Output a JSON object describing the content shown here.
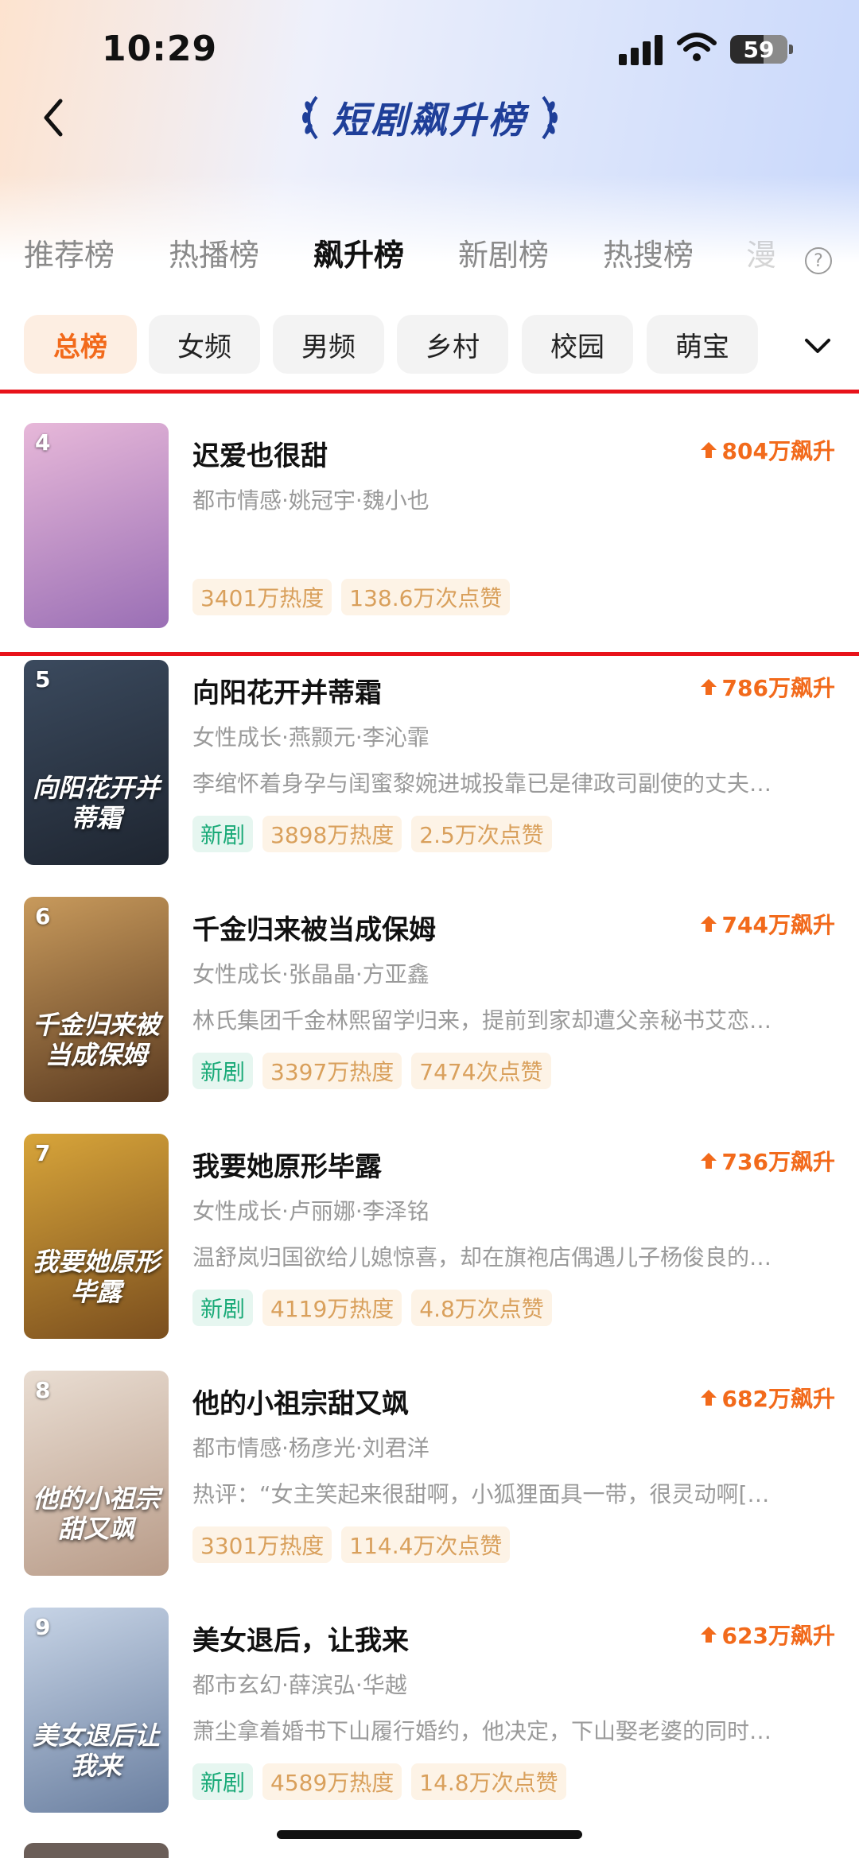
{
  "status_bar": {
    "time": "10:29",
    "battery": "59"
  },
  "header": {
    "title": "短剧飙升榜"
  },
  "main_tabs": [
    {
      "label": "推荐榜"
    },
    {
      "label": "热播榜"
    },
    {
      "label": "飙升榜"
    },
    {
      "label": "新剧榜"
    },
    {
      "label": "热搜榜"
    },
    {
      "label": "漫"
    }
  ],
  "active_main_tab": "飙升榜",
  "filters": [
    {
      "label": "总榜"
    },
    {
      "label": "女频"
    },
    {
      "label": "男频"
    },
    {
      "label": "乡村"
    },
    {
      "label": "校园"
    },
    {
      "label": "萌宝"
    }
  ],
  "active_filter": "总榜",
  "colors": {
    "accent": "#f26a1b",
    "title_blue": "#1f3f99",
    "new_green": "#1aaa78",
    "highlight_red": "#e8121a"
  },
  "items": [
    {
      "rank": "4",
      "title": "迟爱也很甜",
      "rise": "804万飙升",
      "meta": "都市情感·姚冠宇·魏小也",
      "desc": "",
      "new_tag": "",
      "heat": "3401万热度",
      "likes": "138.6万次点赞",
      "poster_text": "",
      "poster_colors": [
        "#e7b8d9",
        "#9a6fb5"
      ]
    },
    {
      "rank": "5",
      "title": "向阳花开并蒂霜",
      "rise": "786万飙升",
      "meta": "女性成长·燕颢元·李沁霏",
      "desc": "李绾怀着身孕与闺蜜黎婉进城投靠已是律政司副使的丈夫…",
      "new_tag": "新剧",
      "heat": "3898万热度",
      "likes": "2.5万次点赞",
      "poster_text": "向阳花开并蒂霜",
      "poster_colors": [
        "#3b4a5e",
        "#1e2530"
      ]
    },
    {
      "rank": "6",
      "title": "千金归来被当成保姆",
      "rise": "744万飙升",
      "meta": "女性成长·张晶晶·方亚鑫",
      "desc": "林氏集团千金林熙留学归来，提前到家却遭父亲秘书艾恋…",
      "new_tag": "新剧",
      "heat": "3397万热度",
      "likes": "7474次点赞",
      "poster_text": "千金归来被当成保姆",
      "poster_colors": [
        "#c89a5c",
        "#5a3a20"
      ]
    },
    {
      "rank": "7",
      "title": "我要她原形毕露",
      "rise": "736万飙升",
      "meta": "女性成长·卢丽娜·李泽铭",
      "desc": "温舒岚归国欲给儿媳惊喜，却在旗袍店偶遇儿子杨俊良的…",
      "new_tag": "新剧",
      "heat": "4119万热度",
      "likes": "4.8万次点赞",
      "poster_text": "我要她原形毕露",
      "poster_colors": [
        "#d8a53a",
        "#7a4e1e"
      ]
    },
    {
      "rank": "8",
      "title": "他的小祖宗甜又飒",
      "rise": "682万飙升",
      "meta": "都市情感·杨彦光·刘君洋",
      "desc": "热评：“女主笑起来很甜啊，小狐狸面具一带，很灵动啊[…",
      "new_tag": "",
      "heat": "3301万热度",
      "likes": "114.4万次点赞",
      "poster_text": "他的小祖宗甜又飒",
      "poster_colors": [
        "#e9ddd2",
        "#b89b88"
      ]
    },
    {
      "rank": "9",
      "title": "美女退后，让我来",
      "rise": "623万飙升",
      "meta": "都市玄幻·薛滨弘·华越",
      "desc": "萧尘拿着婚书下山履行婚约，他决定，下山娶老婆的同时…",
      "new_tag": "新剧",
      "heat": "4589万热度",
      "likes": "14.8万次点赞",
      "poster_text": "美女退后让我来",
      "poster_colors": [
        "#c7d4e6",
        "#6a7fa0"
      ]
    }
  ]
}
